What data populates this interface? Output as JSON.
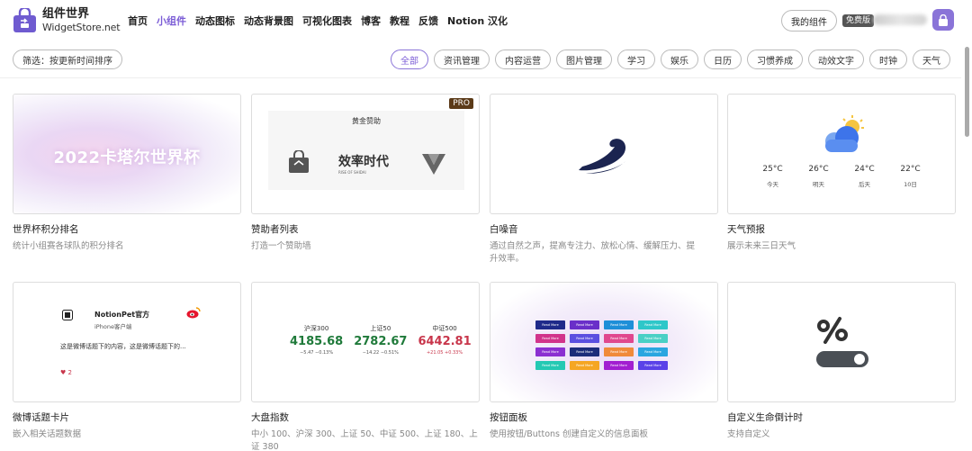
{
  "header": {
    "brand_name": "组件世界",
    "brand_domain": "WidgetStore.net",
    "nav": [
      {
        "label": "首页",
        "active": false
      },
      {
        "label": "小组件",
        "active": true
      },
      {
        "label": "动态图标",
        "active": false
      },
      {
        "label": "动态背景图",
        "active": false
      },
      {
        "label": "可视化图表",
        "active": false
      },
      {
        "label": "博客",
        "active": false
      },
      {
        "label": "教程",
        "active": false
      },
      {
        "label": "反馈",
        "active": false
      },
      {
        "label": "Notion 汉化",
        "active": false
      }
    ],
    "my_widgets": "我的组件",
    "free_badge": "免费版"
  },
  "filter": {
    "sort_label": "筛选：按更新时间排序",
    "categories": [
      "全部",
      "资讯管理",
      "内容运营",
      "图片管理",
      "学习",
      "娱乐",
      "日历",
      "习惯养成",
      "动效文字",
      "时钟",
      "天气"
    ],
    "active_category": "全部"
  },
  "colors": {
    "accent": "#7b5cd6",
    "lock_bg": "#8a74d8",
    "stock_up": "#c8364b",
    "stock_down": "#1f7a3a"
  },
  "cards": [
    {
      "title": "世界杯积分排名",
      "desc": "统计小组赛各球队的积分排名",
      "preview_text": "2022卡塔尔世界杯"
    },
    {
      "title": "赞助者列表",
      "desc": "打造一个赞助墙",
      "badge": "PRO",
      "preview_label": "黄金赞助",
      "preview_brand": "效率时代",
      "preview_brand_sub": "RISE OF SHIDAI"
    },
    {
      "title": "白噪音",
      "desc": "通过自然之声，提高专注力、放松心情、缓解压力、提升效率。"
    },
    {
      "title": "天气预报",
      "desc": "展示未来三日天气",
      "weather": [
        {
          "temp": "25°C",
          "day": "今天"
        },
        {
          "temp": "26°C",
          "day": "明天"
        },
        {
          "temp": "24°C",
          "day": "后天"
        },
        {
          "temp": "22°C",
          "day": "10日"
        }
      ]
    },
    {
      "title": "微博话题卡片",
      "desc": "嵌入相关话题数据",
      "weibo_name": "NotionPet官方",
      "weibo_sub": "iPhone客户端",
      "weibo_content": "这是微博话题下的内容，这是微博话题下的...",
      "weibo_likes": "2"
    },
    {
      "title": "大盘指数",
      "desc": "中小 100、沪深 300、上证 50、中证 500、上证 180、上证 380",
      "markets": [
        {
          "name": "沪深300",
          "value": "4185.68",
          "change": "−5.47 −0.13%",
          "trend": "down"
        },
        {
          "name": "上证50",
          "value": "2782.67",
          "change": "−14.22 −0.51%",
          "trend": "down"
        },
        {
          "name": "中证500",
          "value": "6442.81",
          "change": "+21.05 +0.33%",
          "trend": "up"
        }
      ]
    },
    {
      "title": "按钮面板",
      "desc": "使用按钮/Buttons 创建自定义的信息面板",
      "button_label": "Read More"
    },
    {
      "title": "自定义生命倒计时",
      "desc": "支持自定义"
    }
  ]
}
